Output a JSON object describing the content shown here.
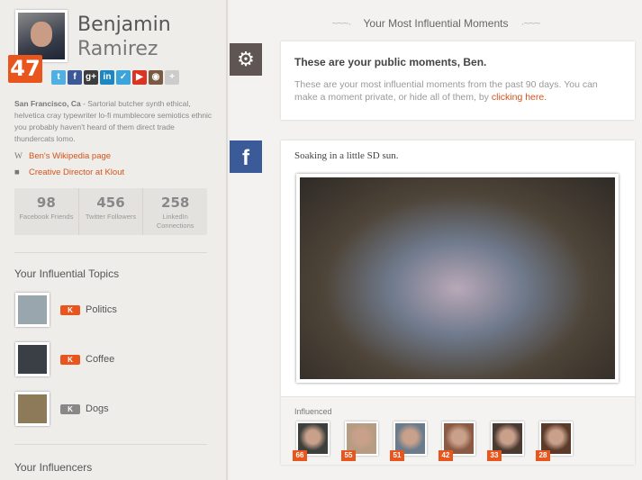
{
  "profile": {
    "first_name": "Benjamin",
    "last_name": "Ramirez",
    "score": "47",
    "location": "San Francisco, Ca",
    "bio": " - Sartorial butcher synth ethical, helvetica cray typewriter lo-fi mumblecore semiotics ethnic you probably haven't heard of them direct trade thundercats lomo.",
    "links": [
      {
        "icon": "wikipedia-icon",
        "label": "Ben's Wikipedia page"
      },
      {
        "icon": "briefcase-icon",
        "label": "Creative Director at Klout"
      }
    ],
    "socials": [
      {
        "name": "twitter",
        "glyph": "t",
        "color": "#4fb1e3"
      },
      {
        "name": "facebook",
        "glyph": "f",
        "color": "#3b5998"
      },
      {
        "name": "google-plus",
        "glyph": "g+",
        "color": "#3d3d3d"
      },
      {
        "name": "linkedin",
        "glyph": "in",
        "color": "#1d87c1"
      },
      {
        "name": "foursquare",
        "glyph": "✓",
        "color": "#3aa4db"
      },
      {
        "name": "youtube",
        "glyph": "▶",
        "color": "#d32"
      },
      {
        "name": "instagram",
        "glyph": "◉",
        "color": "#7a5a40"
      },
      {
        "name": "add",
        "glyph": "+",
        "color": "#ccc"
      }
    ],
    "stats": [
      {
        "value": "98",
        "label": "Facebook Friends"
      },
      {
        "value": "456",
        "label": "Twitter Followers"
      },
      {
        "value": "258",
        "label": "LinkedIn Connections"
      }
    ]
  },
  "topics": {
    "heading": "Your Influential Topics",
    "items": [
      {
        "label": "Politics",
        "active": true,
        "color": "#9aa6ae"
      },
      {
        "label": "Coffee",
        "active": true,
        "color": "#3a3f45"
      },
      {
        "label": "Dogs",
        "active": false,
        "color": "#8c7a58"
      }
    ],
    "k": "K"
  },
  "influencers_heading": "Your Influencers",
  "main": {
    "title": "Your Most Influential Moments",
    "notice": {
      "title": "These are your public moments, Ben.",
      "text": "These are your most influential moments from the past 90 days. You can make a moment private, or hide all of them, by ",
      "link": "clicking here."
    },
    "moment": {
      "caption": "Soaking in a little SD sun.",
      "influenced_label": "Influenced",
      "influenced": [
        {
          "score": "66",
          "color": "#3d3f3c"
        },
        {
          "score": "55",
          "color": "#b59c82"
        },
        {
          "score": "51",
          "color": "#6a7c8c"
        },
        {
          "score": "42",
          "color": "#8a5a44"
        },
        {
          "score": "33",
          "color": "#4b3a32"
        },
        {
          "score": "28",
          "color": "#5a3a2a"
        }
      ]
    }
  }
}
